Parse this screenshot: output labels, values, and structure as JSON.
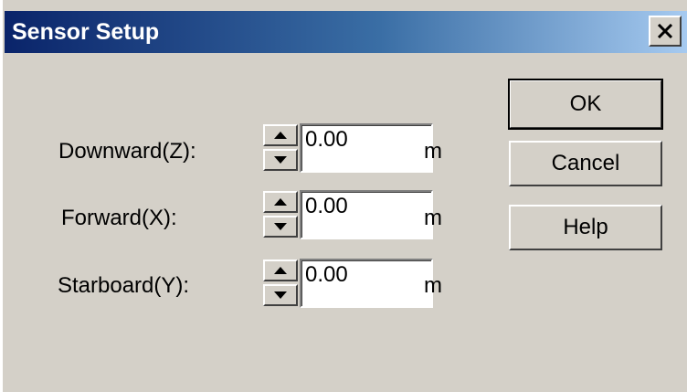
{
  "window": {
    "title": "Sensor Setup",
    "title_gradient": [
      "#0a246a",
      "#3a6ea5",
      "#a6caf0"
    ],
    "close_icon": "close-icon",
    "background": "#d4d0c8"
  },
  "fields": [
    {
      "label": "Downward(Z):",
      "value": "0.00",
      "unit": "m"
    },
    {
      "label": "Forward(X):",
      "value": "0.00",
      "unit": "m"
    },
    {
      "label": "Starboard(Y):",
      "value": "0.00",
      "unit": "m"
    }
  ],
  "buttons": {
    "ok": "OK",
    "cancel": "Cancel",
    "help": "Help"
  }
}
